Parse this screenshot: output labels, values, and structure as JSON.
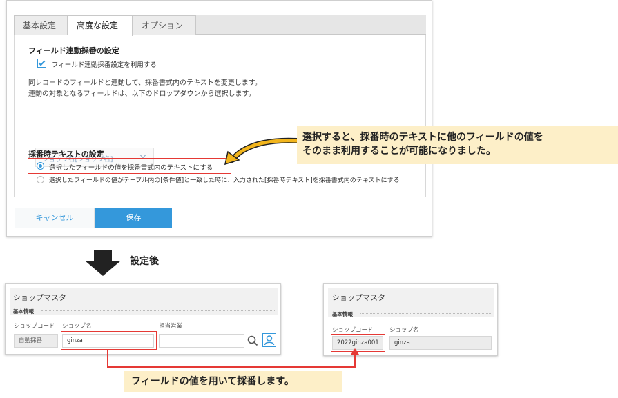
{
  "dialog": {
    "tabs": [
      "基本設定",
      "高度な設定",
      "オプション"
    ],
    "section1_title": "フィールド連動採番の設定",
    "checkbox_label": "フィールド連動採番設定を利用する",
    "description_line1": "同レコードのフィールドと連動して、採番書式内のテキストを変更します。",
    "description_line2": "連動の対象となるフィールドは、以下のドロップダウンから選択します。",
    "dropdown_value": "ショップ名[ショップ名]",
    "section2_title": "採番時テキストの設定",
    "radio1_label": "選択したフィールドの値を採番書式内のテキストにする",
    "radio2_label": "選択したフィールドの値がテーブル内の[条件値]と一致した時に、入力された[採番時テキスト]を採番書式内のテキストにする",
    "cancel_label": "キャンセル",
    "save_label": "保存"
  },
  "callout_top": {
    "line1": "選択すると、採番時のテキストに他のフィールドの値を",
    "line2": "そのまま利用することが可能になりました。"
  },
  "after_label": "設定後",
  "form_left": {
    "title": "ショップマスタ",
    "section": "基本情報",
    "label_code": "ショップコード",
    "label_name": "ショップ名",
    "label_manager": "担当営業",
    "code_value": "自動採番",
    "name_value": "ginza"
  },
  "form_right": {
    "title": "ショップマスタ",
    "section": "基本情報",
    "label_code": "ショップコード",
    "label_name": "ショップ名",
    "code_value": "2022ginza001",
    "name_value": "ginza"
  },
  "callout_bottom": "フィールドの値を用いて採番します。",
  "colors": {
    "accent": "#3498db",
    "highlight_red": "#e53935",
    "callout_bg": "#fdefc8",
    "arrow_yellow": "#f2b51c"
  }
}
